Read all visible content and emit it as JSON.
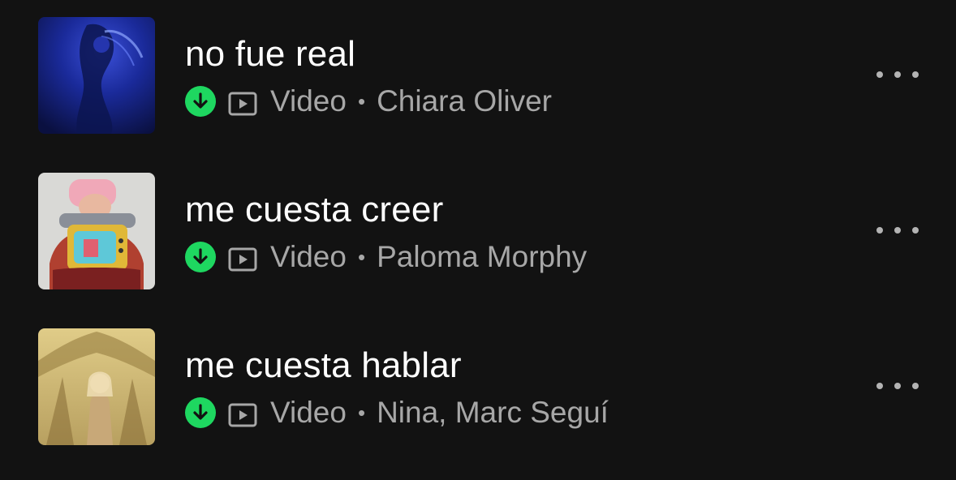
{
  "colors": {
    "background": "#121212",
    "title": "#ffffff",
    "subtitle": "#a7a7a7",
    "download_badge": "#1ed760"
  },
  "tracks": [
    {
      "title": "no fue real",
      "downloaded_icon": "download-arrow-icon",
      "type_icon": "video-icon",
      "type": "Video",
      "separator": "•",
      "artist": "Chiara Oliver",
      "more_icon": "more-options-icon"
    },
    {
      "title": "me cuesta creer",
      "downloaded_icon": "download-arrow-icon",
      "type_icon": "video-icon",
      "type": "Video",
      "separator": "•",
      "artist": "Paloma Morphy",
      "more_icon": "more-options-icon"
    },
    {
      "title": "me cuesta hablar",
      "downloaded_icon": "download-arrow-icon",
      "type_icon": "video-icon",
      "type": "Video",
      "separator": "•",
      "artist": "Nina, Marc Seguí",
      "more_icon": "more-options-icon"
    }
  ]
}
